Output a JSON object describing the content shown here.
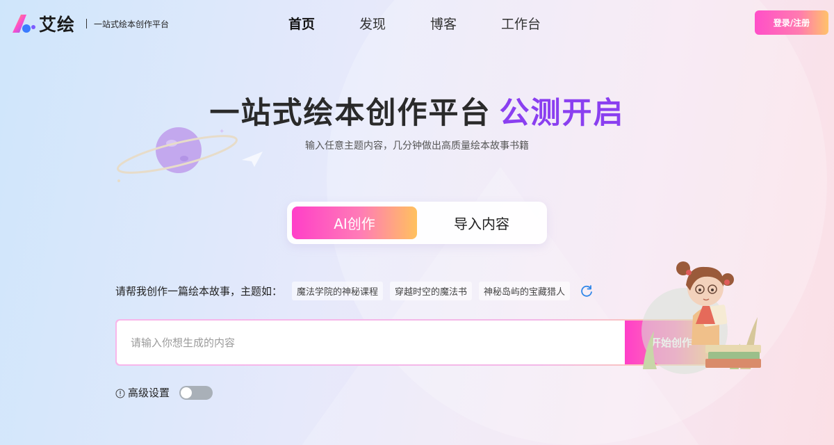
{
  "header": {
    "logo_name": "艾绘",
    "logo_tagline": "一站式绘本创作平台",
    "nav": [
      {
        "label": "首页",
        "active": true
      },
      {
        "label": "发现",
        "active": false
      },
      {
        "label": "博客",
        "active": false
      },
      {
        "label": "工作台",
        "active": false
      }
    ],
    "login_label": "登录/注册"
  },
  "hero": {
    "title": "一站式绘本创作平台",
    "title_accent": "公测开启",
    "subtitle": "输入任意主题内容，几分钟做出高质量绘本故事书籍"
  },
  "mode_tabs": [
    {
      "label": "AI创作",
      "active": true
    },
    {
      "label": "导入内容",
      "active": false
    }
  ],
  "prompt": {
    "label": "请帮我创作一篇绘本故事，主题如：",
    "suggestions": [
      "魔法学院的神秘课程",
      "穿越时空的魔法书",
      "神秘岛屿的宝藏猎人"
    ]
  },
  "input": {
    "placeholder": "请输入你想生成的内容",
    "value": "",
    "submit_label": "开始创作"
  },
  "advanced": {
    "label": "高级设置",
    "enabled": false
  },
  "colors": {
    "accent_purple": "#8a3ff0",
    "gradient_pink": "#ff3fc8",
    "gradient_orange": "#ffc15e",
    "refresh_blue": "#2f86e8"
  },
  "icons": [
    "logo-mark-icon",
    "planet-icon",
    "paper-plane-icon",
    "refresh-icon",
    "info-icon",
    "toggle-switch",
    "girl-reading-illustration"
  ]
}
